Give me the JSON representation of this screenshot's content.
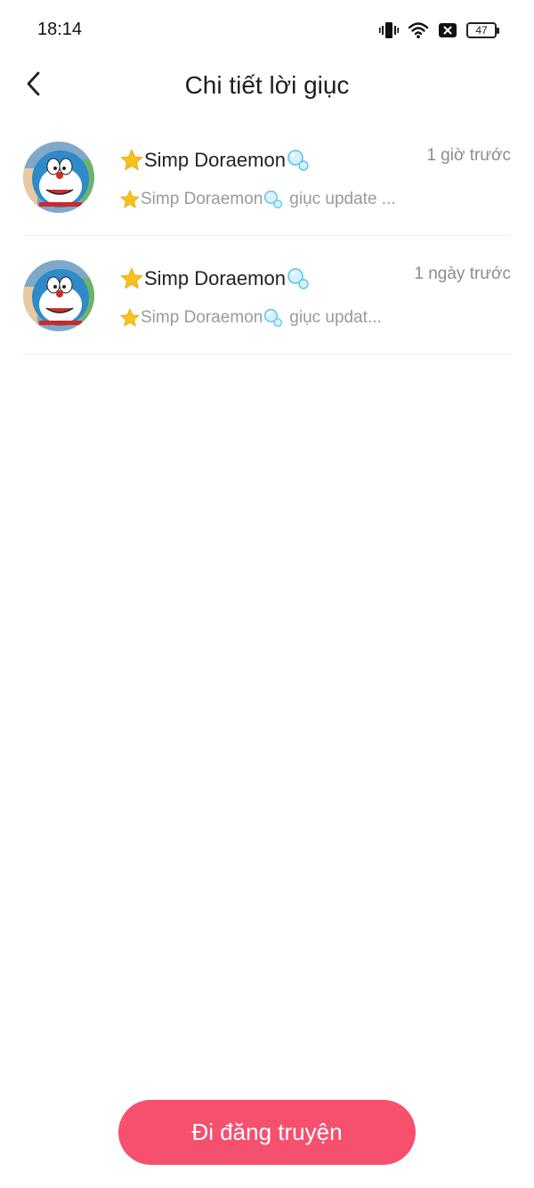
{
  "status_bar": {
    "time": "18:14",
    "battery": "47",
    "icons": [
      "vibrate-icon",
      "wifi-icon",
      "no-signal-icon",
      "battery-icon"
    ]
  },
  "header": {
    "title": "Chi tiết lời giục",
    "back_icon": "chevron-left-icon"
  },
  "items": [
    {
      "name": "Simp Doraemon",
      "time": "1 giờ trước",
      "message": "giục update ..."
    },
    {
      "name": "Simp Doraemon",
      "time": "1 ngày trước",
      "message": "giục updat..."
    }
  ],
  "cta": {
    "label": "Đi đăng truyện"
  },
  "colors": {
    "accent": "#f6506f",
    "time_text": "#8c8c8c",
    "message_text": "#9a9a9a",
    "divider": "#eeeeee"
  }
}
